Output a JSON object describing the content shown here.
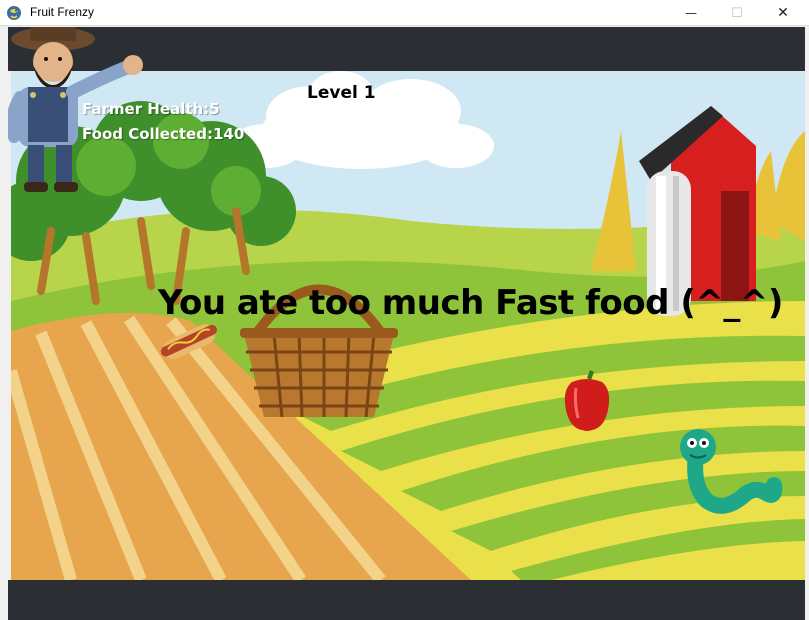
{
  "window": {
    "title": "Fruit Frenzy",
    "min_glyph": "—",
    "max_glyph": "☐",
    "close_glyph": "✕"
  },
  "hud": {
    "health": "Farmer Health:5",
    "food": "Food Collected:140",
    "level": "Level 1"
  },
  "message": "You ate too much Fast food (^_^)",
  "colors": {
    "band": "#2b2f34",
    "sky": "#cfe8f4",
    "hill_green": "#8fc43a",
    "field_yellow": "#e9e04a",
    "dirt": "#e7a64e",
    "barn_red": "#d81f1f"
  },
  "icons": {
    "app": "snake-app-icon",
    "farmer": "farmer-sprite",
    "basket": "basket-sprite",
    "hotdog": "hotdog-sprite",
    "pepper": "red-pepper-sprite",
    "worm": "worm-sprite"
  }
}
